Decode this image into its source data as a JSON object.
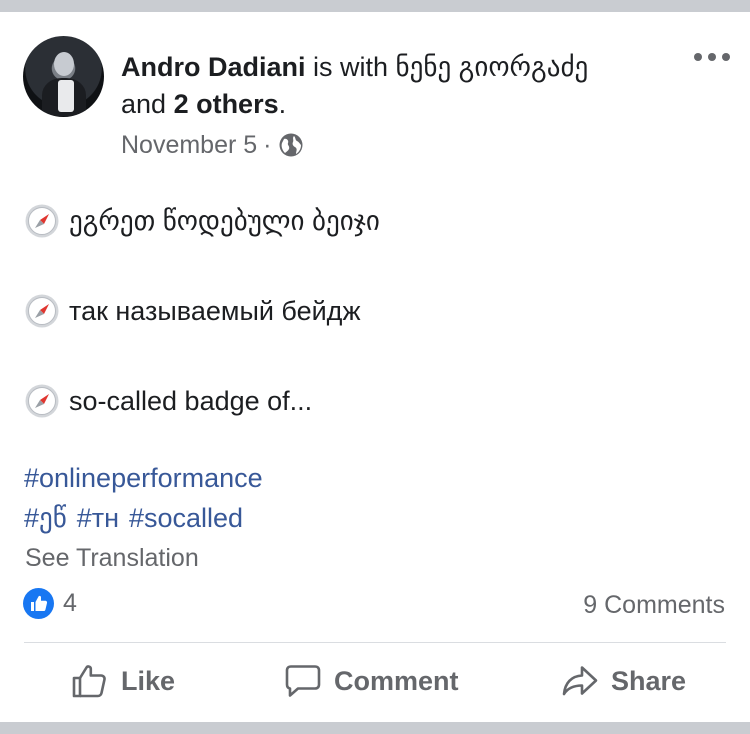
{
  "post": {
    "author": "Andro Dadiani",
    "with_text": " is with ნენე გიორგაძე",
    "and_text": "and ",
    "others": "2 others",
    "period": ".",
    "date": "November 5",
    "meta_separator": "·",
    "lines": [
      {
        "emoji": "compass-emoji-icon",
        "text": "ეგრეთ წოდებული ბეიჯი"
      },
      {
        "emoji": "compass-emoji-icon",
        "text": "так называемый бейдж"
      },
      {
        "emoji": "compass-emoji-icon",
        "text": "so-called badge of..."
      }
    ],
    "hashtags": [
      "#onlineperformance",
      "#ეწ",
      "#тн",
      "#socalled"
    ],
    "see_translation": "See Translation",
    "likes_count": "4",
    "comments_count": "9 Comments"
  },
  "actions": {
    "like": "Like",
    "comment": "Comment",
    "share": "Share"
  },
  "colors": {
    "accent": "#385898",
    "like_blue": "#1877f2",
    "secondary_text": "#65676b",
    "band": "#c9ccd1"
  }
}
